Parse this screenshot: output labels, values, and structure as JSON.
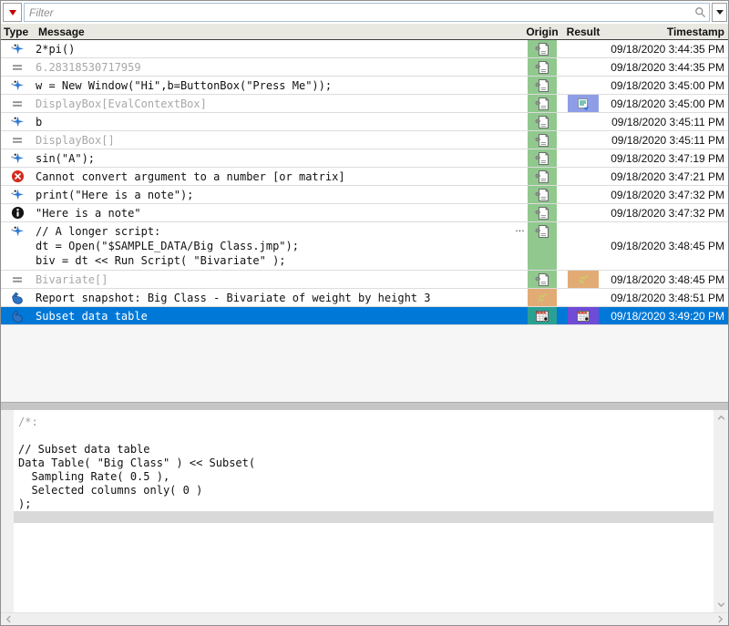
{
  "filter": {
    "placeholder": "Filter"
  },
  "header": {
    "type": "Type",
    "message": "Message",
    "origin": "Origin",
    "result": "Result",
    "timestamp": "Timestamp"
  },
  "colors": {
    "green": "#90c88e",
    "tan": "#e2ab74",
    "teal": "#2aa093",
    "purple": "#6f4bd8",
    "periwinkle": "#8e9ee6",
    "selection": "#0078d7"
  },
  "icons": {
    "type_legend": [
      "run-script-icon",
      "equals-result-icon",
      "error-icon",
      "info-icon",
      "hand-pointer-icon"
    ],
    "cell_legend": [
      "script-file-icon",
      "display-box-icon",
      "scatter-plot-icon",
      "data-table-icon"
    ]
  },
  "table": {
    "rows": [
      {
        "type_icon": "run",
        "message": "2*pi()",
        "origin": {
          "icon": "script-file",
          "color": "green"
        },
        "timestamp": "09/18/2020 3:44:35 PM"
      },
      {
        "type_icon": "equals",
        "message": "6.28318530717959",
        "gray": true,
        "origin": {
          "icon": "script-file",
          "color": "green"
        },
        "timestamp": "09/18/2020 3:44:35 PM"
      },
      {
        "type_icon": "run",
        "message": "w = New Window(\"Hi\",b=ButtonBox(\"Press Me\"));",
        "origin": {
          "icon": "script-file",
          "color": "green"
        },
        "timestamp": "09/18/2020 3:45:00 PM"
      },
      {
        "type_icon": "equals",
        "message": "DisplayBox[EvalContextBox]",
        "gray": true,
        "origin": {
          "icon": "script-file",
          "color": "green"
        },
        "result": {
          "icon": "display-box",
          "color": "periwinkle"
        },
        "timestamp": "09/18/2020 3:45:00 PM"
      },
      {
        "type_icon": "run",
        "message": "b",
        "origin": {
          "icon": "script-file",
          "color": "green"
        },
        "timestamp": "09/18/2020 3:45:11 PM"
      },
      {
        "type_icon": "equals",
        "message": "DisplayBox[]",
        "gray": true,
        "origin": {
          "icon": "script-file",
          "color": "green"
        },
        "timestamp": "09/18/2020 3:45:11 PM"
      },
      {
        "type_icon": "run",
        "message": "sin(\"A\");",
        "origin": {
          "icon": "script-file",
          "color": "green"
        },
        "timestamp": "09/18/2020 3:47:19 PM"
      },
      {
        "type_icon": "error",
        "message": "Cannot convert argument to a number [or matrix]",
        "origin": {
          "icon": "script-file",
          "color": "green"
        },
        "timestamp": "09/18/2020 3:47:21 PM"
      },
      {
        "type_icon": "run",
        "message": "print(\"Here is a note\");",
        "origin": {
          "icon": "script-file",
          "color": "green"
        },
        "timestamp": "09/18/2020 3:47:32 PM"
      },
      {
        "type_icon": "info",
        "message": "\"Here is a note\"",
        "origin": {
          "icon": "script-file",
          "color": "green"
        },
        "timestamp": "09/18/2020 3:47:32 PM"
      },
      {
        "type_icon": "run",
        "lines": [
          "// A longer script:",
          "dt = Open(\"$SAMPLE_DATA/Big Class.jmp\");",
          "biv = dt << Run Script( \"Bivariate\" );"
        ],
        "truncated": "…",
        "origin": {
          "icon": "script-file",
          "color": "green"
        },
        "timestamp": "09/18/2020 3:48:45 PM"
      },
      {
        "type_icon": "equals",
        "message": "Bivariate[]",
        "gray": true,
        "origin": {
          "icon": "script-file",
          "color": "green"
        },
        "result": {
          "icon": "scatter-plot",
          "color": "tan"
        },
        "timestamp": "09/18/2020 3:48:45 PM"
      },
      {
        "type_icon": "hand",
        "message": "Report snapshot: Big Class - Bivariate of weight by height 3",
        "origin": {
          "icon": "scatter-plot",
          "color": "tan"
        },
        "timestamp": "09/18/2020 3:48:51 PM"
      },
      {
        "type_icon": "hand",
        "message": "Subset data table",
        "selected": true,
        "origin": {
          "icon": "data-table",
          "color": "teal"
        },
        "result": {
          "icon": "data-table",
          "color": "purple"
        },
        "timestamp": "09/18/2020 3:49:20 PM"
      }
    ]
  },
  "script": {
    "lines": [
      {
        "text": "/*:",
        "comment": true
      },
      {
        "text": ""
      },
      {
        "text": "// Subset data table"
      },
      {
        "text": "Data Table( \"Big Class\" ) << Subset("
      },
      {
        "text": "  Sampling Rate( 0.5 ),"
      },
      {
        "text": "  Selected columns only( 0 )"
      },
      {
        "text": ");"
      }
    ]
  }
}
